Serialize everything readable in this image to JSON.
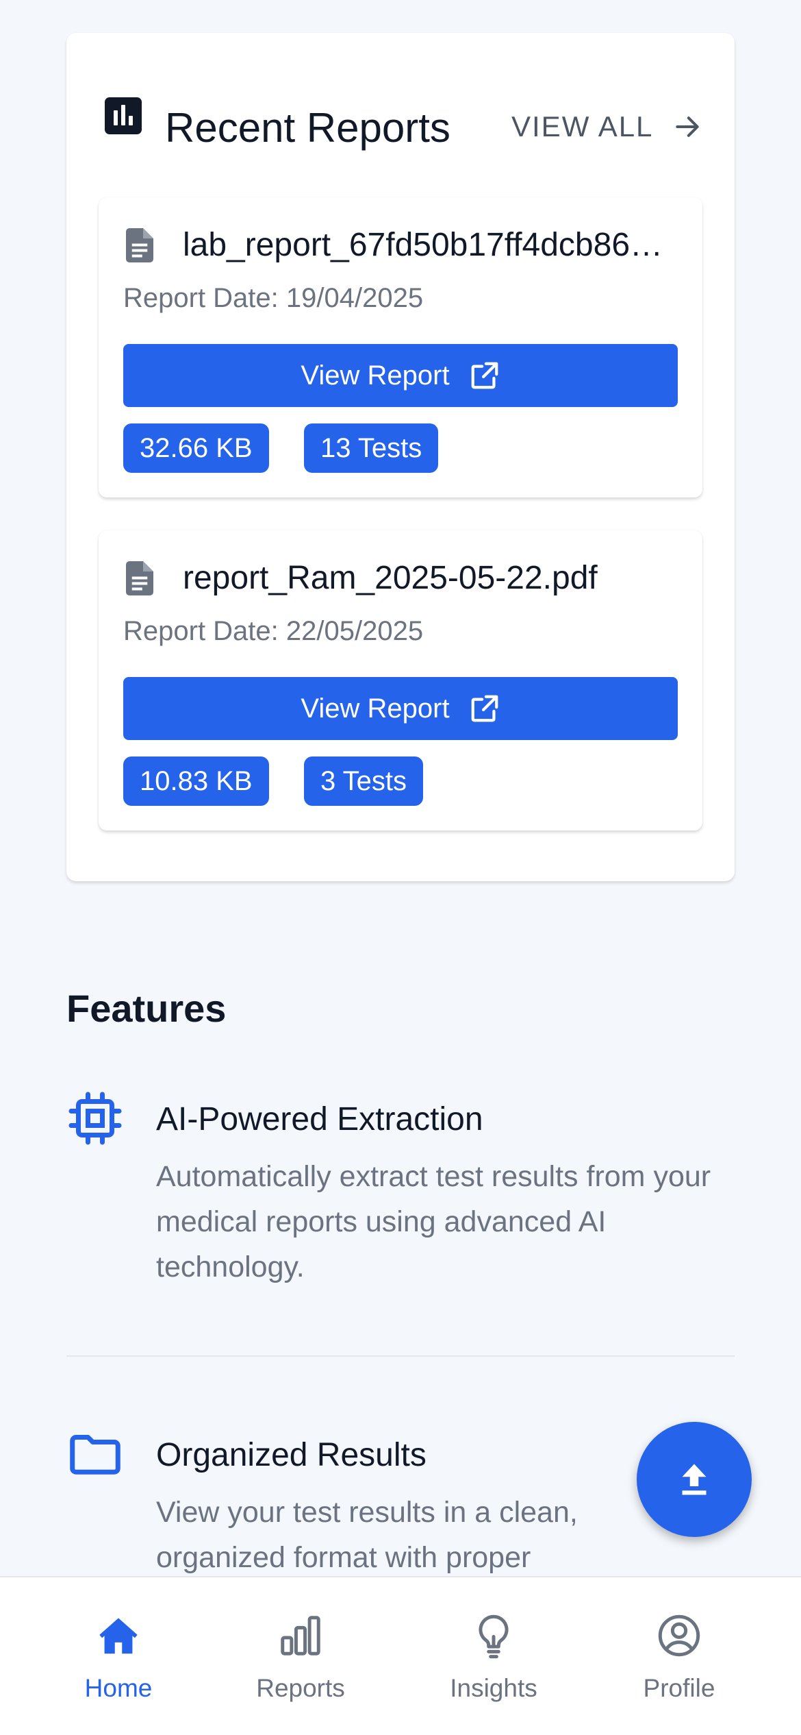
{
  "recent_reports": {
    "title": "Recent Reports",
    "view_all_label": "VIEW ALL",
    "items": [
      {
        "file_name": "lab_report_67fd50b17ff4dcb86…",
        "date_text": "Report Date: 19/04/2025",
        "button_label": "View Report",
        "size": "32.66 KB",
        "tests": "13 Tests"
      },
      {
        "file_name": "report_Ram_2025-05-22.pdf",
        "date_text": "Report Date: 22/05/2025",
        "button_label": "View Report",
        "size": "10.83 KB",
        "tests": "3 Tests"
      }
    ]
  },
  "features": {
    "heading": "Features",
    "items": [
      {
        "icon": "chip-icon",
        "title": "AI-Powered Extraction",
        "description": "Automatically extract test results from your medical reports using advanced AI technology."
      },
      {
        "icon": "folder-icon",
        "title": "Organized Results",
        "description": "View your test results in a clean, organized format with proper"
      }
    ]
  },
  "fab": {
    "icon": "upload-icon"
  },
  "bottom_nav": {
    "items": [
      {
        "label": "Home",
        "icon": "home-icon",
        "active": true
      },
      {
        "label": "Reports",
        "icon": "bar-chart-icon",
        "active": false
      },
      {
        "label": "Insights",
        "icon": "lightbulb-icon",
        "active": false
      },
      {
        "label": "Profile",
        "icon": "user-circle-icon",
        "active": false
      }
    ]
  },
  "colors": {
    "primary": "#2563eb",
    "background": "#f4f7fb",
    "text": "#111827",
    "muted_text": "#6b7280"
  }
}
